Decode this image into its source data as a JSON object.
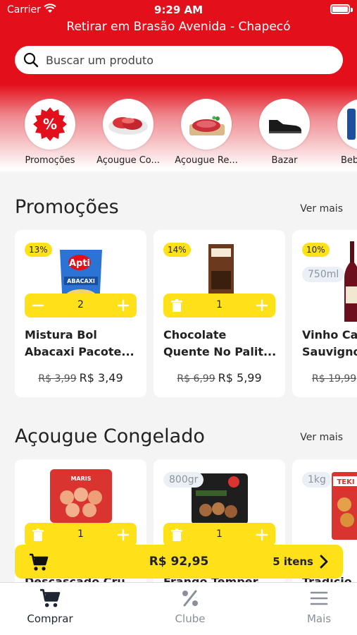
{
  "status": {
    "carrier": "Carrier",
    "time": "9:29 AM"
  },
  "pickup_text": "Retirar em Brasão Avenida - Chapecó",
  "search": {
    "placeholder": "Buscar um produto"
  },
  "categories": [
    {
      "label": "Promoções",
      "icon": "percent-badge-icon"
    },
    {
      "label": "Açougue Co...",
      "icon": "meat-plate-icon"
    },
    {
      "label": "Açougue Re...",
      "icon": "steak-board-icon"
    },
    {
      "label": "Bazar",
      "icon": "shoe-icon"
    },
    {
      "label": "Beb",
      "icon": "bottle-icon"
    }
  ],
  "sections": [
    {
      "title": "Promoções",
      "see_more": "Ver mais",
      "products": [
        {
          "discount": "13%",
          "qty": "2",
          "name1": "Mistura Bol",
          "name2": "Abacaxi Pacote...",
          "old_price": "R$ 3,99",
          "price": "R$ 3,49",
          "image": "cake-mix-package-icon"
        },
        {
          "discount": "14%",
          "qty": "1",
          "name1": "Chocolate",
          "name2": "Quente No Palit...",
          "old_price": "R$ 6,99",
          "price": "R$ 5,99",
          "image": "chocolate-box-icon"
        },
        {
          "discount": "10%",
          "size": "750ml",
          "name1": "Vinho Ca",
          "name2": "Sauvigno",
          "old_price": "R$ 19,99",
          "image": "wine-bottle-icon"
        }
      ]
    },
    {
      "title": "Açougue Congelado",
      "see_more": "Ver mais",
      "products": [
        {
          "qty": "1",
          "name1": "Descascado Cru",
          "image": "shrimp-package-icon"
        },
        {
          "size": "800gr",
          "qty": "1",
          "name1": "Frango Temper",
          "image": "chicken-package-icon"
        },
        {
          "size": "1kg",
          "name1": "Tradicio",
          "image": "nuggets-package-icon"
        }
      ]
    }
  ],
  "cart": {
    "total": "R$ 92,95",
    "items": "5 itens"
  },
  "tabs": [
    {
      "label": "Comprar",
      "icon": "cart-icon",
      "active": true
    },
    {
      "label": "Clube",
      "icon": "percent-icon",
      "active": false
    },
    {
      "label": "Mais",
      "icon": "menu-icon",
      "active": false
    }
  ],
  "colors": {
    "brand_red": "#e3101c",
    "accent_yellow": "#ffe119",
    "tab_inactive": "#8a8f99"
  }
}
